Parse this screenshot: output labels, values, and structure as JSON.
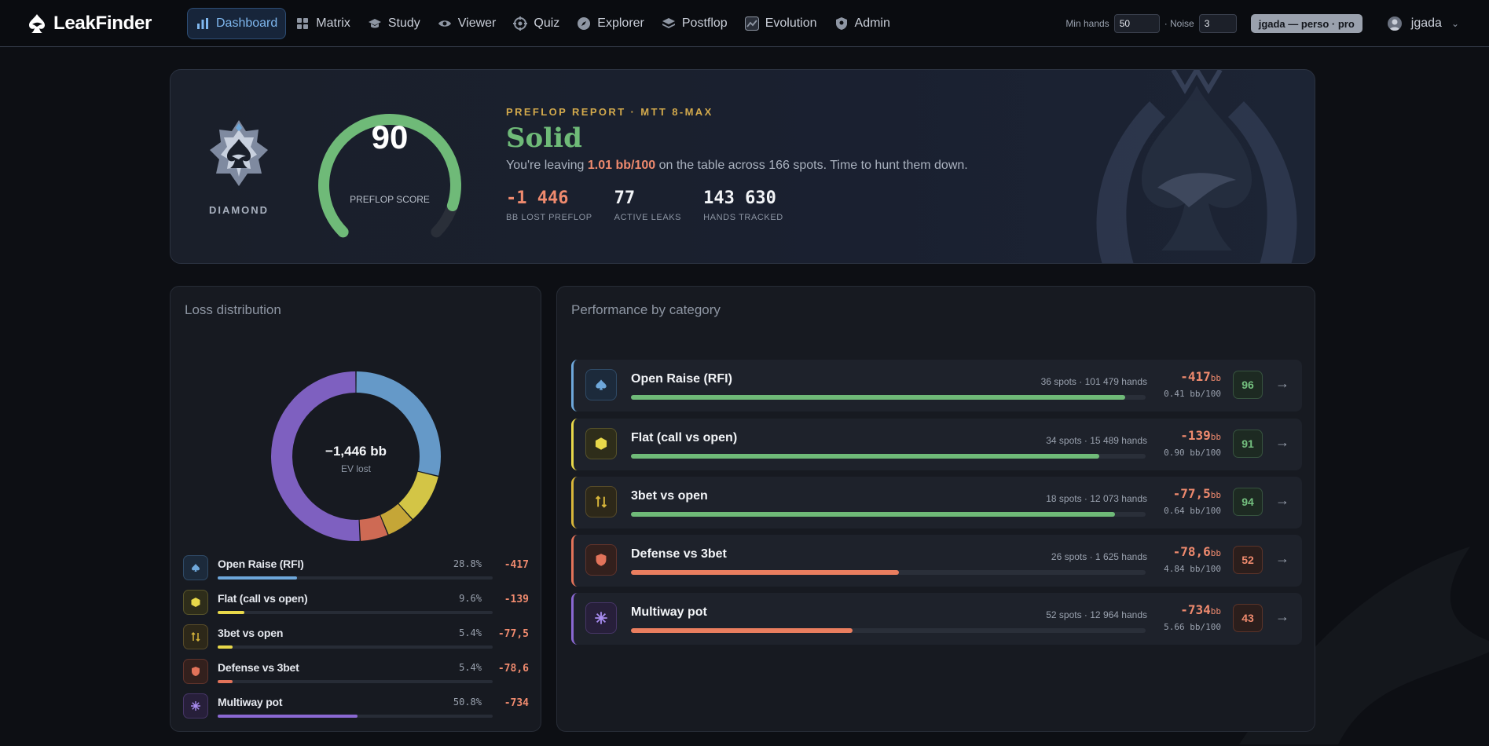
{
  "brand": {
    "name": "LeakFinder"
  },
  "nav": {
    "items": [
      {
        "label": "Dashboard",
        "icon": "bar-chart-icon",
        "active": true
      },
      {
        "label": "Matrix",
        "icon": "grid-icon"
      },
      {
        "label": "Study",
        "icon": "graduation-cap-icon"
      },
      {
        "label": "Viewer",
        "icon": "eye-icon"
      },
      {
        "label": "Quiz",
        "icon": "crosshair-icon"
      },
      {
        "label": "Explorer",
        "icon": "compass-icon"
      },
      {
        "label": "Postflop",
        "icon": "layers-icon"
      },
      {
        "label": "Evolution",
        "icon": "trend-icon"
      },
      {
        "label": "Admin",
        "icon": "shield-icon"
      }
    ],
    "min_hands_label": "Min hands",
    "min_hands_value": "50",
    "noise_label": "· Noise",
    "noise_value": "3",
    "profile": "jgada — perso · pro",
    "username": "jgada"
  },
  "hero": {
    "rank": "DIAMOND",
    "score": "90",
    "score_fraction": 0.9,
    "score_label": "PREFLOP SCORE",
    "kicker": "PREFLOP REPORT · MTT 8-MAX",
    "verdict": "Solid",
    "sentence_pre": "You're leaving ",
    "sentence_hl": "1.01 bb/100",
    "sentence_post": " on the table across 166 spots. Time to hunt them down.",
    "stats": [
      {
        "value": "-1 446",
        "label": "BB LOST PREFLOP"
      },
      {
        "value": "77",
        "label": "ACTIVE LEAKS"
      },
      {
        "value": "143 630",
        "label": "HANDS TRACKED"
      }
    ]
  },
  "loss_panel": {
    "title": "Loss distribution",
    "center_value": "−1,446 bb",
    "center_caption": "EV lost",
    "items": [
      {
        "name": "Open Raise (RFI)",
        "pct": "28.8%",
        "share": 28.8,
        "value": "-417"
      },
      {
        "name": "Flat (call vs open)",
        "pct": "9.6%",
        "share": 9.6,
        "value": "-139"
      },
      {
        "name": "3bet vs open",
        "pct": "5.4%",
        "share": 5.4,
        "value": "-77,5"
      },
      {
        "name": "Defense vs 3bet",
        "pct": "5.4%",
        "share": 5.4,
        "value": "-78,6"
      },
      {
        "name": "Multiway pot",
        "pct": "50.8%",
        "share": 50.8,
        "value": "-734"
      }
    ]
  },
  "perf_panel": {
    "title": "Performance by category",
    "items": [
      {
        "name": "Open Raise (RFI)",
        "meta": "36 spots · 101 479 hands",
        "loss": "-417",
        "unit": "bb",
        "rate": "0.41 bb/100",
        "score": "96",
        "score_num": 96
      },
      {
        "name": "Flat (call vs open)",
        "meta": "34 spots · 15 489 hands",
        "loss": "-139",
        "unit": "bb",
        "rate": "0.90 bb/100",
        "score": "91",
        "score_num": 91
      },
      {
        "name": "3bet vs open",
        "meta": "18 spots · 12 073 hands",
        "loss": "-77,5",
        "unit": "bb",
        "rate": "0.64 bb/100",
        "score": "94",
        "score_num": 94
      },
      {
        "name": "Defense vs 3bet",
        "meta": "26 spots · 1 625 hands",
        "loss": "-78,6",
        "unit": "bb",
        "rate": "4.84 bb/100",
        "score": "52",
        "score_num": 52
      },
      {
        "name": "Multiway pot",
        "meta": "52 spots · 12 964 hands",
        "loss": "-734",
        "unit": "bb",
        "rate": "5.66 bb/100",
        "score": "43",
        "score_num": 43
      }
    ],
    "arrow": "→"
  },
  "colors": {
    "rfi": "#6ea7da",
    "flat": "#e8d84a",
    "threebet": "#d8b63a",
    "defense": "#e2735a",
    "multiway": "#8a68d2",
    "good": "#6fba78",
    "bad": "#ea7e5f"
  }
}
